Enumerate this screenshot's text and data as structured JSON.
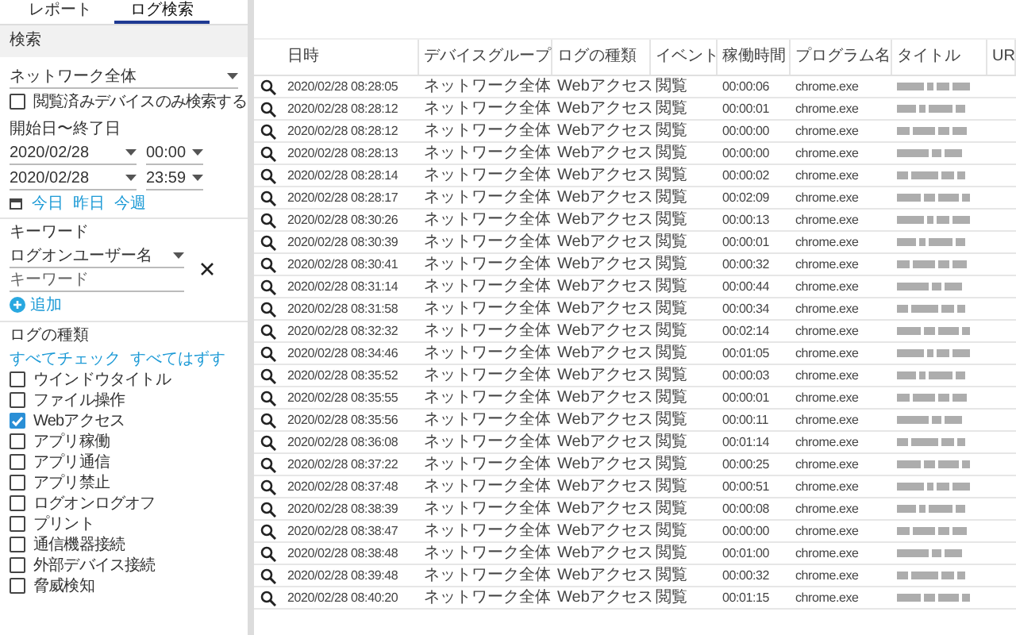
{
  "tabs": [
    {
      "label": "レポート",
      "selected": false
    },
    {
      "label": "ログ検索",
      "selected": true
    }
  ],
  "search_panel": {
    "title": "検索",
    "device_group_select": {
      "value": "ネットワーク全体"
    },
    "viewed_only": {
      "label": "閲覧済みデバイスのみ検索する",
      "checked": false
    },
    "date_range": {
      "label": "開始日〜終了日",
      "start": {
        "date": "2020/02/28",
        "time": "00:00"
      },
      "end": {
        "date": "2020/02/28",
        "time": "23:59"
      },
      "quick_links": [
        "今日",
        "昨日",
        "今週"
      ]
    },
    "keyword": {
      "label": "キーワード",
      "field_select": {
        "value": "ログオンユーザー名"
      },
      "input": {
        "placeholder": "キーワード"
      },
      "add_label": "追加"
    },
    "log_types": {
      "label": "ログの種類",
      "check_all": "すべてチェック",
      "uncheck_all": "すべてはずす",
      "items": [
        {
          "label": "ウインドウタイトル",
          "checked": false
        },
        {
          "label": "ファイル操作",
          "checked": false
        },
        {
          "label": "Webアクセス",
          "checked": true
        },
        {
          "label": "アプリ稼働",
          "checked": false
        },
        {
          "label": "アプリ通信",
          "checked": false
        },
        {
          "label": "アプリ禁止",
          "checked": false
        },
        {
          "label": "ログオンログオフ",
          "checked": false
        },
        {
          "label": "プリント",
          "checked": false
        },
        {
          "label": "通信機器接続",
          "checked": false
        },
        {
          "label": "外部デバイス接続",
          "checked": false
        },
        {
          "label": "脅威検知",
          "checked": false
        }
      ]
    }
  },
  "table": {
    "columns": [
      "日時",
      "デバイスグループ",
      "ログの種類",
      "イベント",
      "稼働時間",
      "プログラム名",
      "タイトル",
      "UR"
    ],
    "rows": [
      {
        "datetime": "2020/02/28 08:28:05",
        "device_group": "ネットワーク全体",
        "log_type": "Webアクセス",
        "event": "閲覧",
        "duration": "00:00:06",
        "program": "chrome.exe"
      },
      {
        "datetime": "2020/02/28 08:28:12",
        "device_group": "ネットワーク全体",
        "log_type": "Webアクセス",
        "event": "閲覧",
        "duration": "00:00:01",
        "program": "chrome.exe"
      },
      {
        "datetime": "2020/02/28 08:28:12",
        "device_group": "ネットワーク全体",
        "log_type": "Webアクセス",
        "event": "閲覧",
        "duration": "00:00:00",
        "program": "chrome.exe"
      },
      {
        "datetime": "2020/02/28 08:28:13",
        "device_group": "ネットワーク全体",
        "log_type": "Webアクセス",
        "event": "閲覧",
        "duration": "00:00:00",
        "program": "chrome.exe"
      },
      {
        "datetime": "2020/02/28 08:28:14",
        "device_group": "ネットワーク全体",
        "log_type": "Webアクセス",
        "event": "閲覧",
        "duration": "00:00:02",
        "program": "chrome.exe"
      },
      {
        "datetime": "2020/02/28 08:28:17",
        "device_group": "ネットワーク全体",
        "log_type": "Webアクセス",
        "event": "閲覧",
        "duration": "00:02:09",
        "program": "chrome.exe"
      },
      {
        "datetime": "2020/02/28 08:30:26",
        "device_group": "ネットワーク全体",
        "log_type": "Webアクセス",
        "event": "閲覧",
        "duration": "00:00:13",
        "program": "chrome.exe"
      },
      {
        "datetime": "2020/02/28 08:30:39",
        "device_group": "ネットワーク全体",
        "log_type": "Webアクセス",
        "event": "閲覧",
        "duration": "00:00:01",
        "program": "chrome.exe"
      },
      {
        "datetime": "2020/02/28 08:30:41",
        "device_group": "ネットワーク全体",
        "log_type": "Webアクセス",
        "event": "閲覧",
        "duration": "00:00:32",
        "program": "chrome.exe"
      },
      {
        "datetime": "2020/02/28 08:31:14",
        "device_group": "ネットワーク全体",
        "log_type": "Webアクセス",
        "event": "閲覧",
        "duration": "00:00:44",
        "program": "chrome.exe"
      },
      {
        "datetime": "2020/02/28 08:31:58",
        "device_group": "ネットワーク全体",
        "log_type": "Webアクセス",
        "event": "閲覧",
        "duration": "00:00:34",
        "program": "chrome.exe"
      },
      {
        "datetime": "2020/02/28 08:32:32",
        "device_group": "ネットワーク全体",
        "log_type": "Webアクセス",
        "event": "閲覧",
        "duration": "00:02:14",
        "program": "chrome.exe"
      },
      {
        "datetime": "2020/02/28 08:34:46",
        "device_group": "ネットワーク全体",
        "log_type": "Webアクセス",
        "event": "閲覧",
        "duration": "00:01:05",
        "program": "chrome.exe"
      },
      {
        "datetime": "2020/02/28 08:35:52",
        "device_group": "ネットワーク全体",
        "log_type": "Webアクセス",
        "event": "閲覧",
        "duration": "00:00:03",
        "program": "chrome.exe"
      },
      {
        "datetime": "2020/02/28 08:35:55",
        "device_group": "ネットワーク全体",
        "log_type": "Webアクセス",
        "event": "閲覧",
        "duration": "00:00:01",
        "program": "chrome.exe"
      },
      {
        "datetime": "2020/02/28 08:35:56",
        "device_group": "ネットワーク全体",
        "log_type": "Webアクセス",
        "event": "閲覧",
        "duration": "00:00:11",
        "program": "chrome.exe"
      },
      {
        "datetime": "2020/02/28 08:36:08",
        "device_group": "ネットワーク全体",
        "log_type": "Webアクセス",
        "event": "閲覧",
        "duration": "00:01:14",
        "program": "chrome.exe"
      },
      {
        "datetime": "2020/02/28 08:37:22",
        "device_group": "ネットワーク全体",
        "log_type": "Webアクセス",
        "event": "閲覧",
        "duration": "00:00:25",
        "program": "chrome.exe"
      },
      {
        "datetime": "2020/02/28 08:37:48",
        "device_group": "ネットワーク全体",
        "log_type": "Webアクセス",
        "event": "閲覧",
        "duration": "00:00:51",
        "program": "chrome.exe"
      },
      {
        "datetime": "2020/02/28 08:38:39",
        "device_group": "ネットワーク全体",
        "log_type": "Webアクセス",
        "event": "閲覧",
        "duration": "00:00:08",
        "program": "chrome.exe"
      },
      {
        "datetime": "2020/02/28 08:38:47",
        "device_group": "ネットワーク全体",
        "log_type": "Webアクセス",
        "event": "閲覧",
        "duration": "00:00:00",
        "program": "chrome.exe"
      },
      {
        "datetime": "2020/02/28 08:38:48",
        "device_group": "ネットワーク全体",
        "log_type": "Webアクセス",
        "event": "閲覧",
        "duration": "00:01:00",
        "program": "chrome.exe"
      },
      {
        "datetime": "2020/02/28 08:39:48",
        "device_group": "ネットワーク全体",
        "log_type": "Webアクセス",
        "event": "閲覧",
        "duration": "00:00:32",
        "program": "chrome.exe"
      },
      {
        "datetime": "2020/02/28 08:40:20",
        "device_group": "ネットワーク全体",
        "log_type": "Webアクセス",
        "event": "閲覧",
        "duration": "00:01:15",
        "program": "chrome.exe"
      }
    ]
  }
}
